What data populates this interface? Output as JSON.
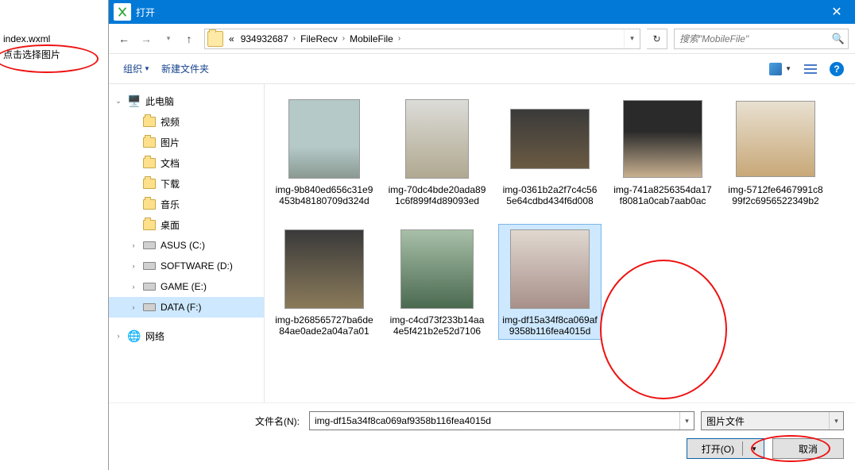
{
  "app_bg": {
    "filename": "index.wxml",
    "btn_text": "点击选择图片"
  },
  "dialog": {
    "title": "打开",
    "breadcrumbs": [
      "«",
      "934932687",
      "FileRecv",
      "MobileFile"
    ],
    "search_placeholder": "搜索\"MobileFile\"",
    "toolbar": {
      "organize": "组织",
      "new_folder": "新建文件夹"
    },
    "sidebar": {
      "root": "此电脑",
      "items": [
        {
          "label": "视频",
          "type": "folder"
        },
        {
          "label": "图片",
          "type": "folder"
        },
        {
          "label": "文档",
          "type": "folder"
        },
        {
          "label": "下载",
          "type": "folder"
        },
        {
          "label": "音乐",
          "type": "folder"
        },
        {
          "label": "桌面",
          "type": "folder"
        },
        {
          "label": "ASUS (C:)",
          "type": "drive"
        },
        {
          "label": "SOFTWARE (D:)",
          "type": "drive"
        },
        {
          "label": "GAME (E:)",
          "type": "drive"
        },
        {
          "label": "DATA (F:)",
          "type": "drive",
          "selected": true
        }
      ],
      "network": "网络"
    },
    "files": [
      {
        "name": "img-9b840ed656c31e9453b4818070​9d324d",
        "thumb": "dog1"
      },
      {
        "name": "img-70dc4bde20ada891c6f899f4d8​9093ed",
        "thumb": "dog2"
      },
      {
        "name": "img-0361b2a2f7c4c565e64cdbd434​f6d008",
        "thumb": "dog3"
      },
      {
        "name": "img-741a825635​4da17f8081a0cab7​aab0ac",
        "thumb": "dog4"
      },
      {
        "name": "img-5712fe6467991c899f2c6956522​349b2",
        "thumb": "dog5"
      },
      {
        "name": "img-b268565727ba6de84ae0ade2a0​4a7a01",
        "thumb": "dog6"
      },
      {
        "name": "img-c4cd73f23​3b14aa4e5f421b2e5​2d7106",
        "thumb": "dog7"
      },
      {
        "name": "img-df15a34f8ca069af9358b116fea4015d",
        "thumb": "dog8",
        "selected": true
      }
    ],
    "footer": {
      "filename_label": "文件名(N):",
      "filename_value": "img-df15a34f8ca069af9358b116fea4015d",
      "filter_label": "图片文件",
      "open_label": "打开(O)",
      "cancel_label": "取消"
    }
  }
}
